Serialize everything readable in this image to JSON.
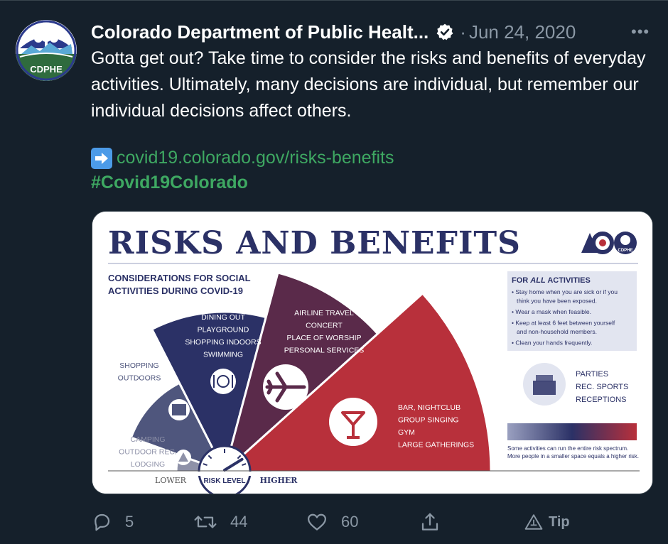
{
  "tweet": {
    "author_name": "Colorado Department of Public Healt...",
    "date_separator": "·",
    "date": "Jun 24, 2020",
    "more_label": "•••",
    "text": "Gotta get out? Take time to consider the risks and benefits of everyday activities. Ultimately, many decisions are individual, but remember our individual decisions affect others.",
    "link": "covid19.colorado.gov/risks-benefits",
    "hashtag": "#Covid19Colorado",
    "avatar_label": "CDPHE"
  },
  "infographic": {
    "title": "RISKS AND BENEFITS",
    "subtitle_1": "CONSIDERATIONS FOR SOCIAL",
    "subtitle_2": "ACTIVITIES DURING COVID-19",
    "logo_label": "CDPHE",
    "tiers": [
      {
        "lines": [
          "CAMPING",
          "OUTDOOR REC.",
          "LODGING"
        ]
      },
      {
        "lines": [
          "SHOPPING",
          "OUTDOORS"
        ]
      },
      {
        "lines": [
          "DINING OUT",
          "PLAYGROUND",
          "SHOPPING INDOORS",
          "SWIMMING"
        ]
      },
      {
        "lines": [
          "AIRLINE TRAVEL",
          "CONCERT",
          "PLACE OF WORSHIP",
          "PERSONAL SERVICES"
        ]
      },
      {
        "lines": [
          "BAR, NIGHTCLUB",
          "GROUP SINGING",
          "GYM",
          "LARGE GATHERINGS"
        ]
      }
    ],
    "all_activities": {
      "heading_pre": "FOR ",
      "heading_em": "ALL",
      "heading_post": " ACTIVITIES",
      "bullets": [
        [
          "• Stay home when you are sick or if you",
          "think you have been exposed."
        ],
        [
          "• Wear a mask when feasible."
        ],
        [
          "• Keep at least 6 feet between yourself",
          "and non-household members."
        ],
        [
          "• Clean your hands frequently."
        ]
      ]
    },
    "spectrum_items": [
      "PARTIES",
      "REC. SPORTS",
      "RECEPTIONS"
    ],
    "spectrum_note_1": "Some activities can run the entire risk spectrum.",
    "spectrum_note_2": "More people in a smaller space equals a higher risk.",
    "scale_lower": "LOWER",
    "scale_label": "RISK LEVEL",
    "scale_higher": "HIGHER",
    "colors": {
      "tier1": "#8e91a8",
      "tier2": "#4f567d",
      "tier3": "#2b3166",
      "tier4": "#5a2a4a",
      "tier5": "#b8303b",
      "navy": "#2b3166"
    }
  },
  "actions": {
    "reply_count": "5",
    "retweet_count": "44",
    "like_count": "60",
    "tip_label": "Tip",
    "icons": [
      "reply-icon",
      "retweet-icon",
      "like-icon",
      "share-icon",
      "tip-icon"
    ]
  }
}
